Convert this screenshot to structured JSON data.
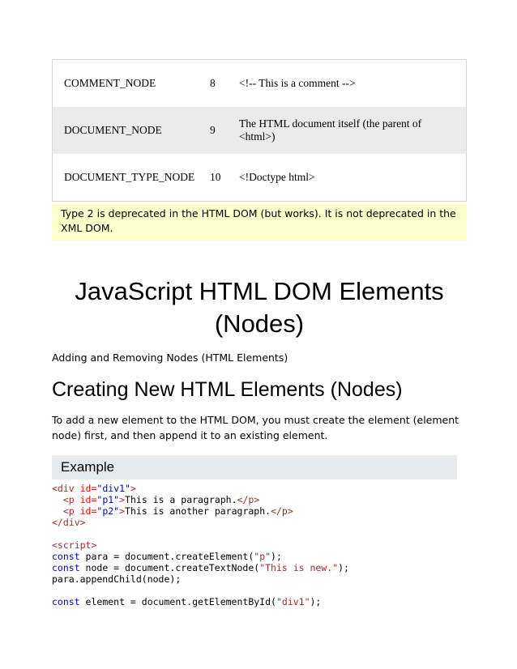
{
  "table": {
    "rows": [
      {
        "name": "COMMENT_NODE",
        "value": "8",
        "description": "<!-- This is a comment -->"
      },
      {
        "name": "DOCUMENT_NODE",
        "value": "9",
        "description": "The HTML document itself (the parent of <html>)"
      },
      {
        "name": "DOCUMENT_TYPE_NODE",
        "value": "10",
        "description": "<!Doctype html>"
      }
    ]
  },
  "note": {
    "text": "Type 2 is deprecated in the HTML DOM (but works). It is not deprecated in the XML DOM."
  },
  "main": {
    "title": "JavaScript HTML DOM Elements (Nodes)",
    "subtitle": "Adding and Removing Nodes (HTML Elements)",
    "section_heading": "Creating New HTML Elements (Nodes)",
    "paragraph": "To add a new element to the HTML DOM, you must create the element (element node) first, and then append it to an existing element.",
    "example_label": "Example"
  },
  "code": {
    "lines": [
      [
        [
          "tag",
          "<div "
        ],
        [
          "attr",
          "id="
        ],
        [
          "val",
          "\"div1\""
        ],
        [
          "tag",
          ">"
        ]
      ],
      [
        [
          "tag",
          "  <p "
        ],
        [
          "attr",
          "id="
        ],
        [
          "val",
          "\"p1\""
        ],
        [
          "tag",
          ">"
        ],
        [
          "plain",
          "This is a paragraph."
        ],
        [
          "tag",
          "</p>"
        ]
      ],
      [
        [
          "tag",
          "  <p "
        ],
        [
          "attr",
          "id="
        ],
        [
          "val",
          "\"p2\""
        ],
        [
          "tag",
          ">"
        ],
        [
          "plain",
          "This is another paragraph."
        ],
        [
          "tag",
          "</p>"
        ]
      ],
      [
        [
          "tag",
          "</div>"
        ]
      ],
      [],
      [
        [
          "tag",
          "<script>"
        ]
      ],
      [
        [
          "kw",
          "const"
        ],
        [
          "plain",
          " para = document.createElement("
        ],
        [
          "str",
          "\"p\""
        ],
        [
          "plain",
          ");"
        ]
      ],
      [
        [
          "kw",
          "const"
        ],
        [
          "plain",
          " node = document.createTextNode("
        ],
        [
          "str",
          "\"This is new.\""
        ],
        [
          "plain",
          ");"
        ]
      ],
      [
        [
          "plain",
          "para.appendChild(node);"
        ]
      ],
      [],
      [
        [
          "kw",
          "const"
        ],
        [
          "plain",
          " element = document.getElementById("
        ],
        [
          "str",
          "\"div1\""
        ],
        [
          "plain",
          ");"
        ]
      ]
    ]
  },
  "colors": {
    "tag": "#a52a2a",
    "attribute": "#ff0000",
    "attribute_value": "#0000cd",
    "js_keyword": "#0000cd",
    "js_string": "#a52a2a",
    "note_background": "#ffffcc",
    "example_header_background": "#e7e9eb",
    "table_stripe": "#ebebeb",
    "table_border": "#d6d6d6"
  }
}
